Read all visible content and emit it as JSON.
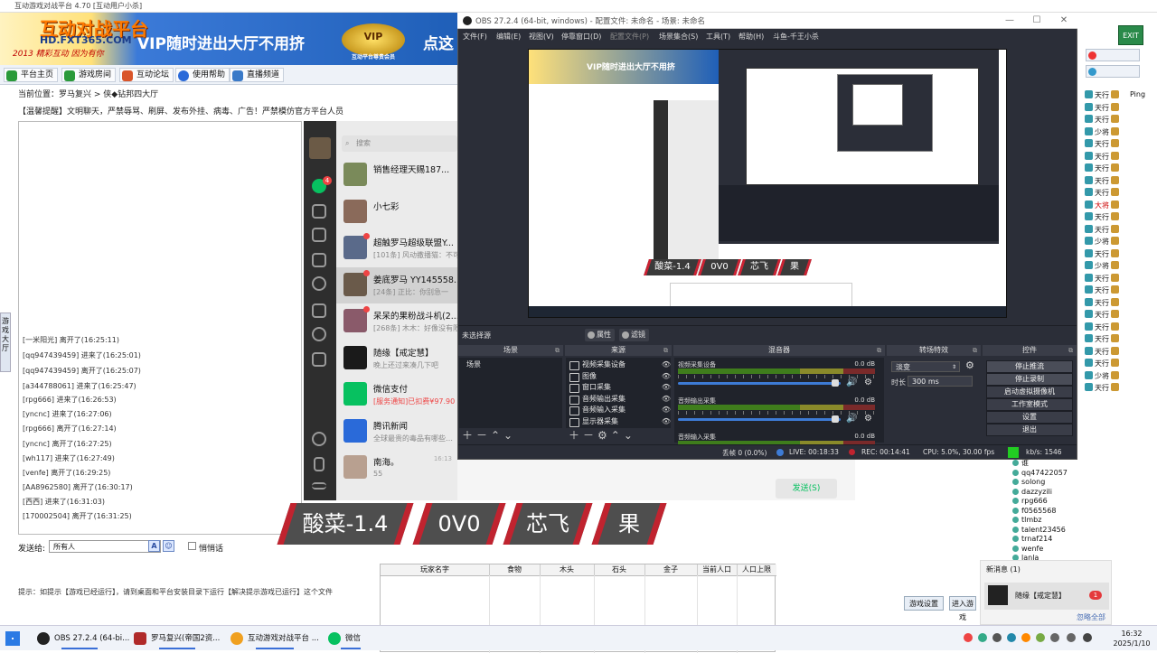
{
  "background_app": {
    "title": "互动游戏对战平台 4.70 [互动用户小杀]",
    "logo_text": "互动对战平台",
    "logo_domain": "HD.FXT365.COM",
    "logo_slogan": "2013 精彩互动 因为有你",
    "banner_text": "VIP随时进出大厅不用挤",
    "banner_tail": "点这",
    "vip_badge": "VIP",
    "vip_badge_sub": "互动平台尊贵会员",
    "toolbar": [
      "平台主页",
      "游戏房间",
      "互动论坛",
      "使用帮助",
      "直播频道"
    ],
    "location_line": "当前位置：罗马复兴 > 侠◆钻邦四大厅",
    "announcement_line": "【温馨提醒】文明聊天，严禁辱骂、刷屏、发布外挂、病毒、广告！严禁模仿官方平台人员",
    "side_tab": "游戏大厅",
    "chat_log": [
      "[一米阳光] 离开了(16:25:11)",
      "[qq947439459] 进来了(16:25:01)",
      "[qq947439459] 离开了(16:25:07)",
      "[a344788061] 进来了(16:25:47)",
      "[rpg666] 进来了(16:26:53)",
      "[yncnc] 进来了(16:27:06)",
      "[rpg666] 离开了(16:27:14)",
      "[yncnc] 离开了(16:27:25)",
      "[wh117] 进来了(16:27:49)",
      "[venfe] 离开了(16:29:25)",
      "[AA8962580] 离开了(16:30:17)",
      "[西西] 进来了(16:31:03)",
      "[170002504] 离开了(16:31:25)"
    ],
    "send_to_label": "发送给:",
    "send_to_value": "所有人",
    "private_chat_label": "悄悄话",
    "hint_line": "提示：如提示【游戏已经运行】，请到桌面和平台安装目录下运行【解决提示游戏已运行】这个文件",
    "exit_button": "EXIT 退出",
    "ping_label": "Ping",
    "right_list": [
      "天行",
      "天行",
      "天行",
      "少将",
      "天行",
      "天行",
      "天行",
      "天行",
      "天行",
      "大将",
      "天行",
      "天行",
      "少将",
      "天行",
      "少将",
      "天行",
      "天行",
      "天行",
      "天行",
      "天行",
      "天行",
      "天行",
      "天行",
      "少将",
      "天行"
    ],
    "room_users": [
      "谁",
      "qq47422057",
      "solong",
      "dazzyzili",
      "rpg666",
      "f0565568",
      "tlmbz",
      "talent23456",
      "trnaf214",
      "wenfe",
      "lanla"
    ],
    "table_headers": [
      "玩家名字",
      "食物",
      "木头",
      "石头",
      "金子",
      "当前人口",
      "人口上限"
    ],
    "game_settings_button": "游戏设置",
    "join_game_button": "进入游戏"
  },
  "wechat": {
    "search_placeholder": "搜索",
    "send_button": "发送(S)",
    "chats": [
      {
        "name": "销售经理天赐187...",
        "sub": "",
        "badge": false,
        "time": ""
      },
      {
        "name": "小七彩",
        "sub": "",
        "badge": false,
        "time": ""
      },
      {
        "name": "超触罗马超级联盟Y...",
        "sub": "[101条] 风动撒播猫：不可",
        "badge": true,
        "time": ""
      },
      {
        "name": "姜底罗马 YY145558...",
        "sub": "[24条] 正比：你别急一",
        "badge": true,
        "time": ""
      },
      {
        "name": "呆呆的果粉战斗机(2...",
        "sub": "[268条] 木木：好像没有限",
        "badge": true,
        "time": ""
      },
      {
        "name": "随缘【戒定慧】",
        "sub": "晚上还过来凑几下吧",
        "badge": false,
        "time": ""
      },
      {
        "name": "微信支付",
        "sub": "[服务通知]已扣费¥97.90",
        "badge": false,
        "time": ""
      },
      {
        "name": "腾讯新闻",
        "sub": "全球最贵的毒品有哪些…",
        "badge": false,
        "time": ""
      },
      {
        "name": "南海。",
        "sub": "55",
        "badge": false,
        "time": "16:13"
      }
    ],
    "unread_count": "4"
  },
  "obs": {
    "title": "OBS 27.2.4 (64-bit, windows) - 配置文件: 未命名 - 场景: 未命名",
    "menu": [
      "文件(F)",
      "编辑(E)",
      "视图(V)",
      "停靠窗口(D)",
      "配置文件(P)",
      "场景集合(S)",
      "工具(T)",
      "帮助(H)",
      "斗鱼-千王小杀"
    ],
    "no_source_selected": "未选择源",
    "properties_button": "属性",
    "filters_button": "滤镜",
    "docks": {
      "scenes": "场景",
      "sources": "来源",
      "mixer": "混音器",
      "transitions": "转场特效",
      "controls": "控件"
    },
    "scene_items": [
      "场景"
    ],
    "sources": [
      "视频采集设备",
      "图像",
      "窗口采集",
      "音频输出采集",
      "音频输入采集",
      "显示器采集"
    ],
    "mixer": [
      {
        "name": "视频采集设备",
        "db": "0.0 dB"
      },
      {
        "name": "音频输出采集",
        "db": "0.0 dB"
      },
      {
        "name": "音频输入采集",
        "db": "0.0 dB"
      }
    ],
    "transition_type": "淡变",
    "duration_label": "时长",
    "duration_value": "300 ms",
    "controls": [
      "停止推流",
      "停止录制",
      "启动虚拟摄像机",
      "工作室模式",
      "设置",
      "退出"
    ],
    "status": {
      "dropped": "丢帧 0 (0.0%)",
      "live": "LIVE: 00:18:33",
      "rec": "REC: 00:14:41",
      "cpu": "CPU: 5.0%, 30.00 fps",
      "kbps": "kb/s: 1546"
    },
    "status_green": "#22cc22"
  },
  "overlay_names": [
    "酸菜-1.4",
    "0V0",
    "芯飞",
    "果"
  ],
  "notification": {
    "title": "新消息 (1)",
    "sender": "随缘【戒定慧】",
    "badge": "1",
    "ignore_all": "忽略全部"
  },
  "taskbar": {
    "apps": [
      "OBS 27.2.4 (64-bi...",
      "罗马复兴(帝国2资...",
      "互动游戏对战平台 ...",
      "微信"
    ],
    "time": "16:32",
    "date": "2025/1/10"
  },
  "colors": {
    "obs_bg": "#2b2e38",
    "overlay_red": "#c0232f",
    "wechat_green": "#07c160"
  }
}
